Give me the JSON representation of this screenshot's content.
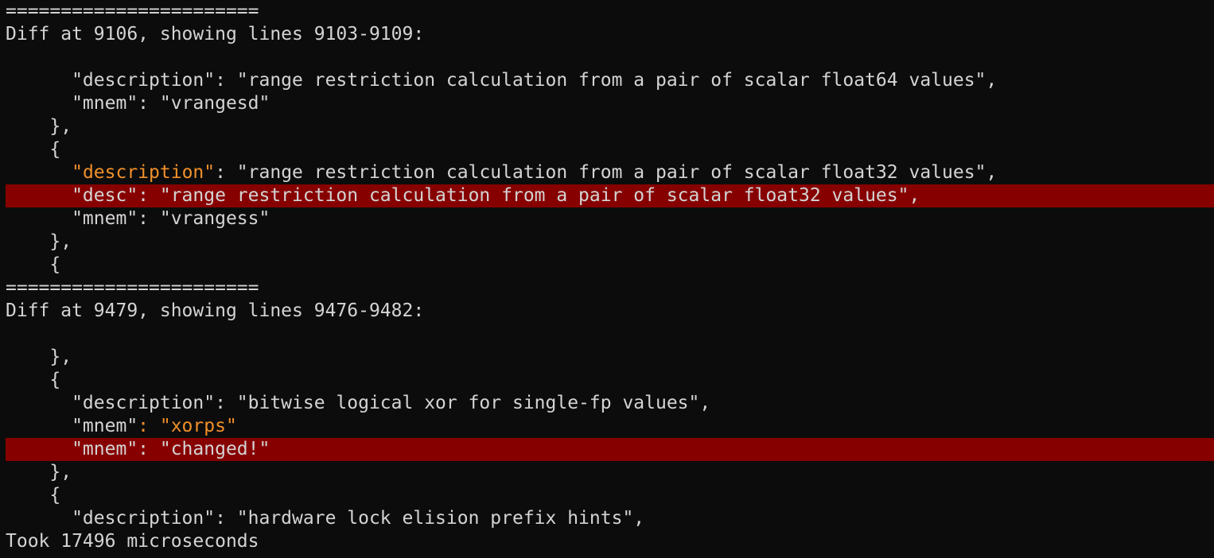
{
  "colors": {
    "background": "#0c0c0c",
    "text": "#d4d4d4",
    "highlight": "#f0902a",
    "removed_line_bg": "#870000"
  },
  "lines": [
    {
      "segments": [
        {
          "text": "=======================",
          "hl": false
        }
      ],
      "type": "separator"
    },
    {
      "segments": [
        {
          "text": "Diff at 9106, showing lines 9103-9109:",
          "hl": false
        }
      ],
      "type": "header"
    },
    {
      "segments": [
        {
          "text": "",
          "hl": false
        }
      ],
      "type": "blank"
    },
    {
      "segments": [
        {
          "text": "      \"description\": \"range restriction calculation from a pair of scalar float64 values\",",
          "hl": false
        }
      ],
      "type": "context"
    },
    {
      "segments": [
        {
          "text": "      \"mnem\": \"vrangesd\"",
          "hl": false
        }
      ],
      "type": "context"
    },
    {
      "segments": [
        {
          "text": "    },",
          "hl": false
        }
      ],
      "type": "context"
    },
    {
      "segments": [
        {
          "text": "    {",
          "hl": false
        }
      ],
      "type": "context"
    },
    {
      "segments": [
        {
          "text": "      ",
          "hl": false
        },
        {
          "text": "\"description\"",
          "hl": true
        },
        {
          "text": ": \"range restriction calculation from a pair of scalar float32 values\",",
          "hl": false
        }
      ],
      "type": "changed"
    },
    {
      "segments": [
        {
          "text": "      \"desc\": \"range restriction calculation from a pair of scalar float32 values\",",
          "hl": false
        }
      ],
      "type": "removed"
    },
    {
      "segments": [
        {
          "text": "      \"mnem\": \"vrangess\"",
          "hl": false
        }
      ],
      "type": "context"
    },
    {
      "segments": [
        {
          "text": "    },",
          "hl": false
        }
      ],
      "type": "context"
    },
    {
      "segments": [
        {
          "text": "    {",
          "hl": false
        }
      ],
      "type": "context"
    },
    {
      "segments": [
        {
          "text": "=======================",
          "hl": false
        }
      ],
      "type": "separator"
    },
    {
      "segments": [
        {
          "text": "Diff at 9479, showing lines 9476-9482:",
          "hl": false
        }
      ],
      "type": "header"
    },
    {
      "segments": [
        {
          "text": "",
          "hl": false
        }
      ],
      "type": "blank"
    },
    {
      "segments": [
        {
          "text": "    },",
          "hl": false
        }
      ],
      "type": "context"
    },
    {
      "segments": [
        {
          "text": "    {",
          "hl": false
        }
      ],
      "type": "context"
    },
    {
      "segments": [
        {
          "text": "      \"description\": \"bitwise logical xor for single-fp values\",",
          "hl": false
        }
      ],
      "type": "context"
    },
    {
      "segments": [
        {
          "text": "      \"mnem\"",
          "hl": false
        },
        {
          "text": ": \"xorps\"",
          "hl": true
        }
      ],
      "type": "changed"
    },
    {
      "segments": [
        {
          "text": "      \"mnem\": \"changed!\"",
          "hl": false
        }
      ],
      "type": "removed"
    },
    {
      "segments": [
        {
          "text": "    },",
          "hl": false
        }
      ],
      "type": "context"
    },
    {
      "segments": [
        {
          "text": "    {",
          "hl": false
        }
      ],
      "type": "context"
    },
    {
      "segments": [
        {
          "text": "      \"description\": \"hardware lock elision prefix hints\",",
          "hl": false
        }
      ],
      "type": "context"
    },
    {
      "segments": [
        {
          "text": "Took 17496 microseconds",
          "hl": false
        }
      ],
      "type": "footer"
    }
  ]
}
